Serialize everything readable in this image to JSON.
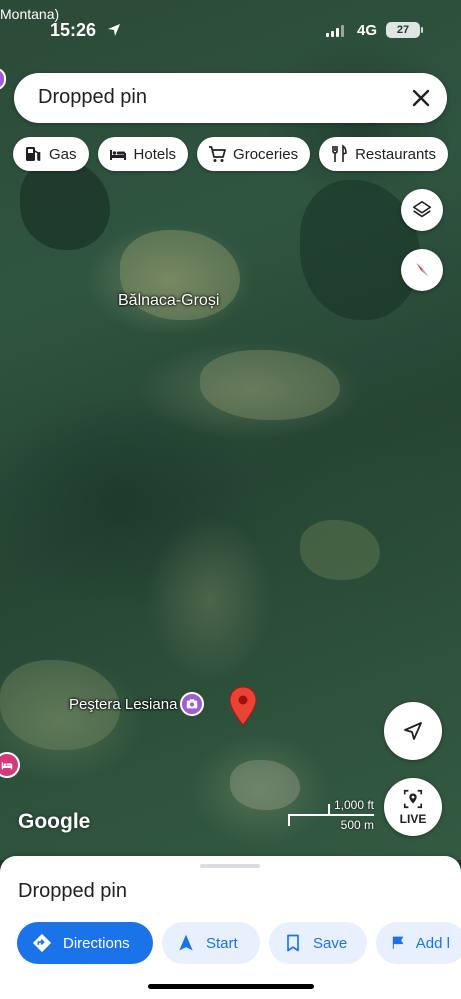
{
  "status_bar": {
    "place_label": "Montana)",
    "time": "15:26",
    "network": "4G",
    "battery": "27"
  },
  "search": {
    "text": "Dropped pin"
  },
  "chips": [
    {
      "label": "Gas",
      "icon": "gas-station-icon"
    },
    {
      "label": "Hotels",
      "icon": "bed-icon"
    },
    {
      "label": "Groceries",
      "icon": "cart-icon"
    },
    {
      "label": "Restaurants",
      "icon": "fork-knife-icon"
    }
  ],
  "map": {
    "village_label": "Bălnaca-Groși",
    "poi_label": "Peştera Lesiana",
    "brand": "Google",
    "scale_ft": "1,000 ft",
    "scale_m": "500 m",
    "live_label": "LIVE"
  },
  "sheet": {
    "title": "Dropped pin",
    "actions": [
      {
        "label": "Directions",
        "icon": "directions-icon"
      },
      {
        "label": "Start",
        "icon": "navigation-arrow-icon"
      },
      {
        "label": "Save",
        "icon": "bookmark-icon"
      },
      {
        "label": "Add l",
        "icon": "flag-icon"
      }
    ]
  },
  "colors": {
    "accent": "#1a73e8",
    "pin": "#ea4335",
    "poi": "#a05bd6",
    "hotel": "#d6387a"
  }
}
